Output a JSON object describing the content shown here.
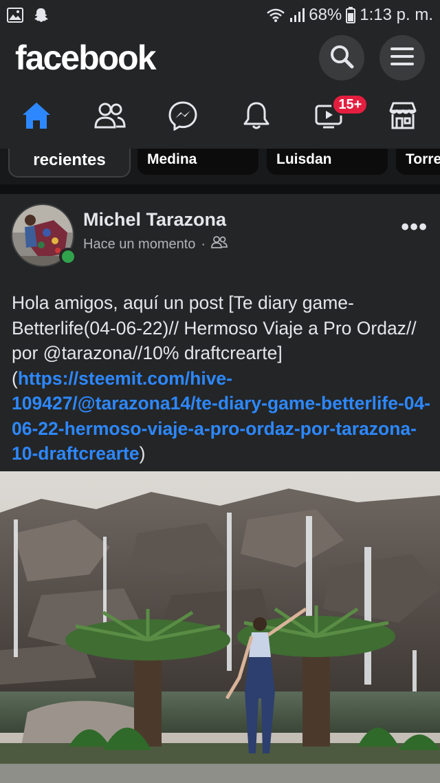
{
  "status_bar": {
    "battery": "68%",
    "time": "1:13 p. m.",
    "icons": [
      "image-icon",
      "snapchat-icon",
      "wifi-icon",
      "signal-icon",
      "battery-icon"
    ]
  },
  "header": {
    "logo": "facebook",
    "search_icon": "search-icon",
    "menu_icon": "menu-icon"
  },
  "nav": {
    "tabs": [
      {
        "name": "home",
        "icon": "home-icon",
        "active": true
      },
      {
        "name": "friends",
        "icon": "friends-icon"
      },
      {
        "name": "messenger",
        "icon": "messenger-icon"
      },
      {
        "name": "notifications",
        "icon": "bell-icon"
      },
      {
        "name": "watch",
        "icon": "video-icon",
        "badge": "15+"
      },
      {
        "name": "marketplace",
        "icon": "store-icon"
      }
    ],
    "accent": "#2d88ff",
    "badge_color": "#e41e3f"
  },
  "stories": {
    "recent_label": "recientes",
    "items": [
      "Medina",
      "Luisdan",
      "Torre"
    ]
  },
  "post": {
    "author": "Michel Tarazona",
    "time": "Hace un momento",
    "separator": "·",
    "audience_icon": "friends-icon",
    "more": "•••",
    "text_plain": "Hola amigos, aquí un post [Te diary game- Betterlife(04-06-22)// Hermoso Viaje a Pro Ordaz// por @tarazona//10% draftcrearte](",
    "link": "https://steemit.com/hive-109427/@tarazona14/te-diary-game-betterlife-04-06-22-hermoso-viaje-a-pro-ordaz-por-tarazona-10-draftcrearte",
    "text_end": ")",
    "online_color": "#31a24c"
  }
}
